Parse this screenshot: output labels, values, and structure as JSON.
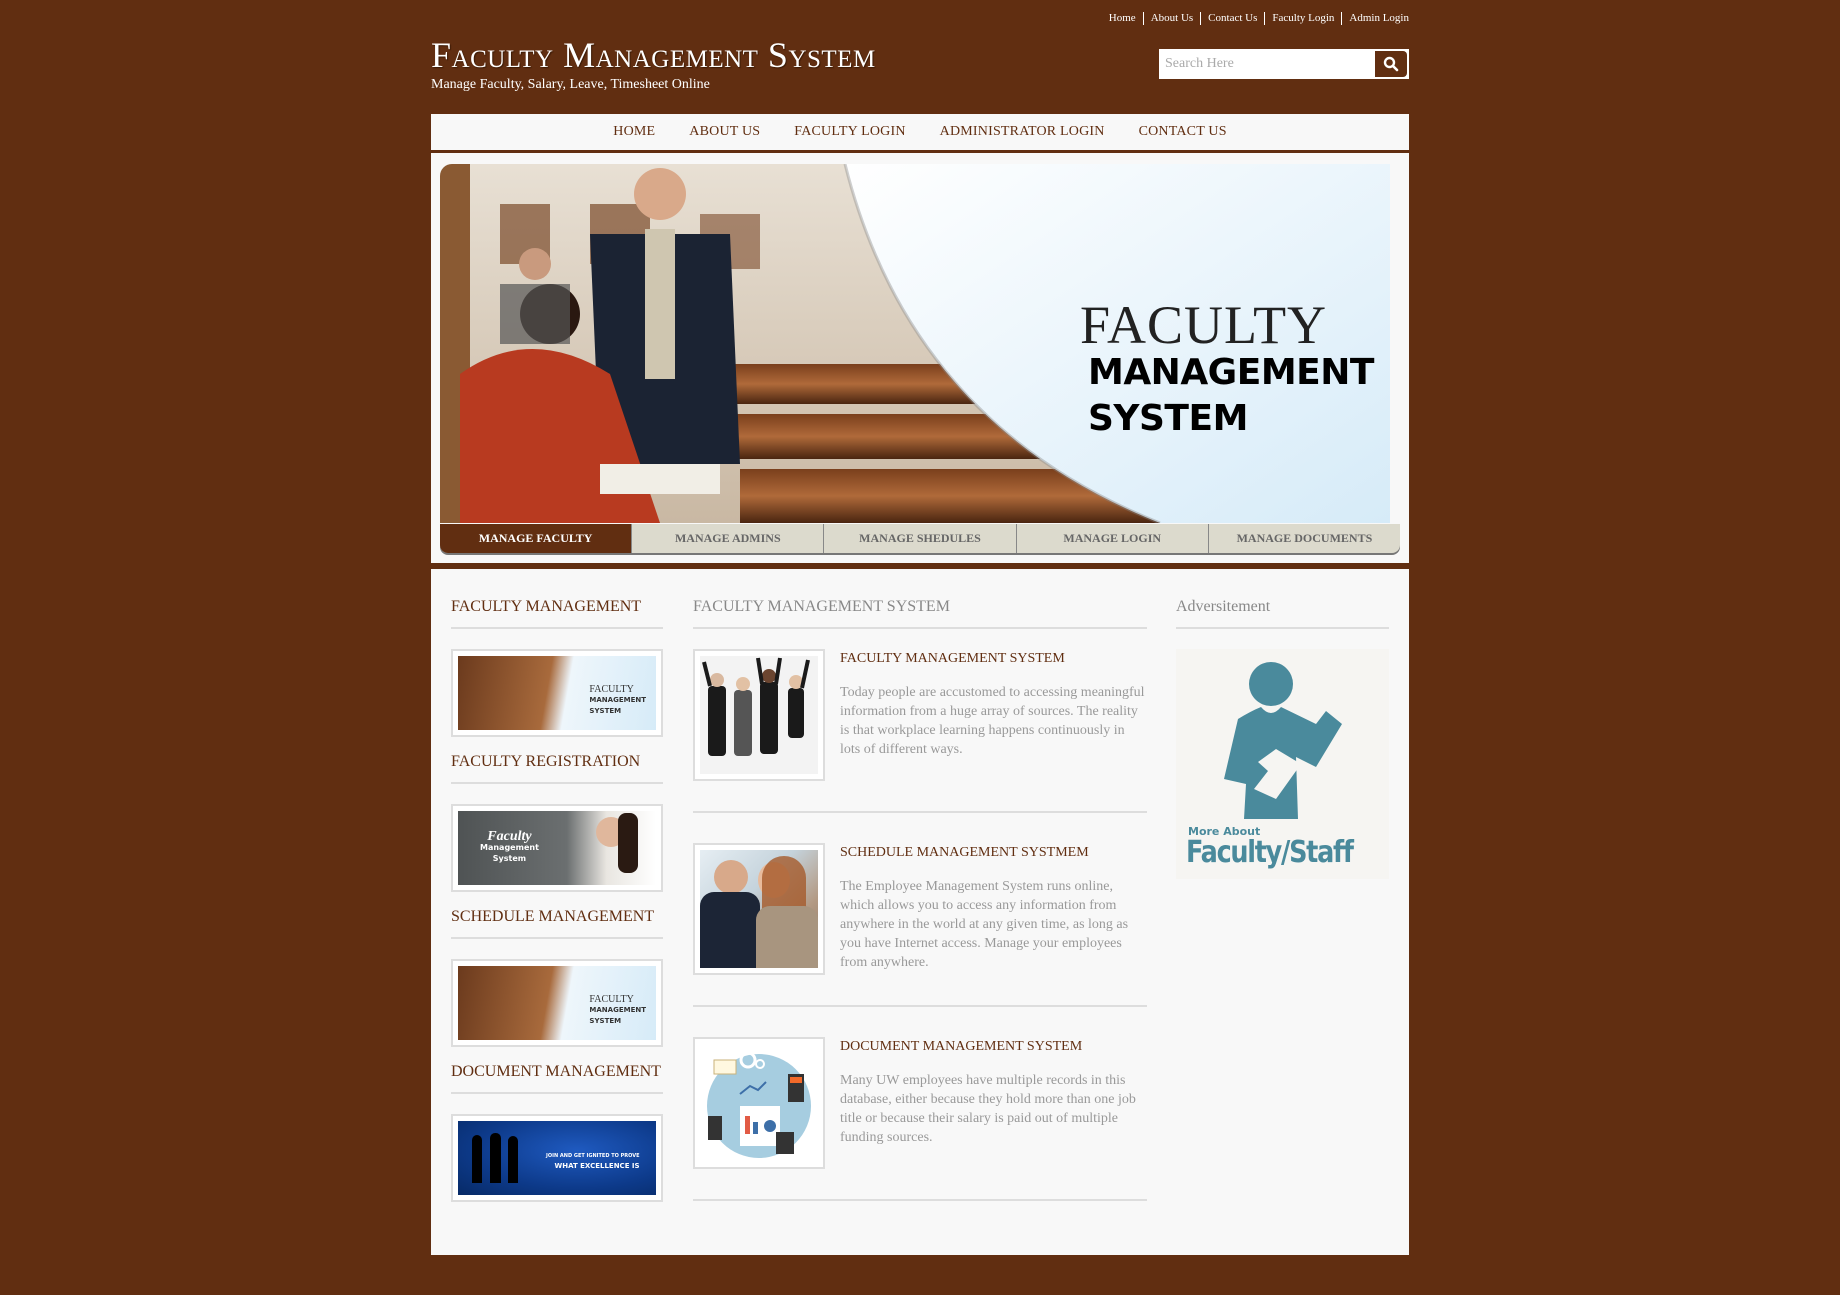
{
  "top_links": [
    "Home",
    "About Us",
    "Contact Us",
    "Faculty Login",
    "Admin Login"
  ],
  "header": {
    "title": "Faculty Management System",
    "subtitle": "Manage Faculty, Salary, Leave, Timesheet Online"
  },
  "search": {
    "placeholder": "Search Here",
    "value": "",
    "icon": "search-icon"
  },
  "main_nav": [
    "HOME",
    "ABOUT US",
    "FACULTY LOGIN",
    "ADMINISTRATOR LOGIN",
    "CONTACT US"
  ],
  "banner": {
    "line1": "FACULTY",
    "line2": "MANAGEMENT",
    "line3": "SYSTEM"
  },
  "tabs": [
    "MANAGE FACULTY",
    "MANAGE ADMINS",
    "MANAGE SHEDULES",
    "MANAGE LOGIN",
    "MANAGE DOCUMENTS"
  ],
  "active_tab": "MANAGE FACULTY",
  "sidebar": {
    "sections": [
      {
        "heading": "FACULTY MANAGEMENT",
        "image_text": [
          "FACULTY",
          "MANAGEMENT",
          "SYSTEM"
        ]
      },
      {
        "heading": "FACULTY REGISTRATION",
        "image_text": [
          "Faculty",
          "Management",
          "System"
        ]
      },
      {
        "heading": "SCHEDULE MANAGEMENT",
        "image_text": [
          "FACULTY",
          "MANAGEMENT",
          "SYSTEM"
        ]
      },
      {
        "heading": "DOCUMENT MANAGEMENT",
        "image_text": [
          "JOIN AND GET IGNITED TO PROVE",
          "WHAT EXCELLENCE IS"
        ]
      }
    ]
  },
  "main": {
    "heading": "FACULTY MANAGEMENT SYSTEM",
    "items": [
      {
        "title": "FACULTY MANAGEMENT SYSTEM",
        "text": "Today people are accustomed to accessing meaningful information from a huge array of sources. The reality is that workplace learning happens continuously in lots of different ways."
      },
      {
        "title": "SCHEDULE MANAGEMENT SYSTMEM",
        "text": "The Employee Management System runs online, which allows you to access any information from anywhere in the world at any given time, as long as you have Internet access. Manage your employees from anywhere."
      },
      {
        "title": "DOCUMENT MANAGEMENT SYSTEM",
        "text": "Many UW employees have multiple records in this database, either because they hold more than one job title or because their salary is paid out of multiple funding sources."
      }
    ]
  },
  "advertisement": {
    "heading": "Adversitement",
    "line1": "More About",
    "line2": "Faculty/Staff"
  },
  "colors": {
    "brand_brown": "#612e11",
    "tab_inactive": "#dcdacd",
    "ad_teal": "#4a8a9c",
    "page_bg": "#f8f8f8"
  }
}
